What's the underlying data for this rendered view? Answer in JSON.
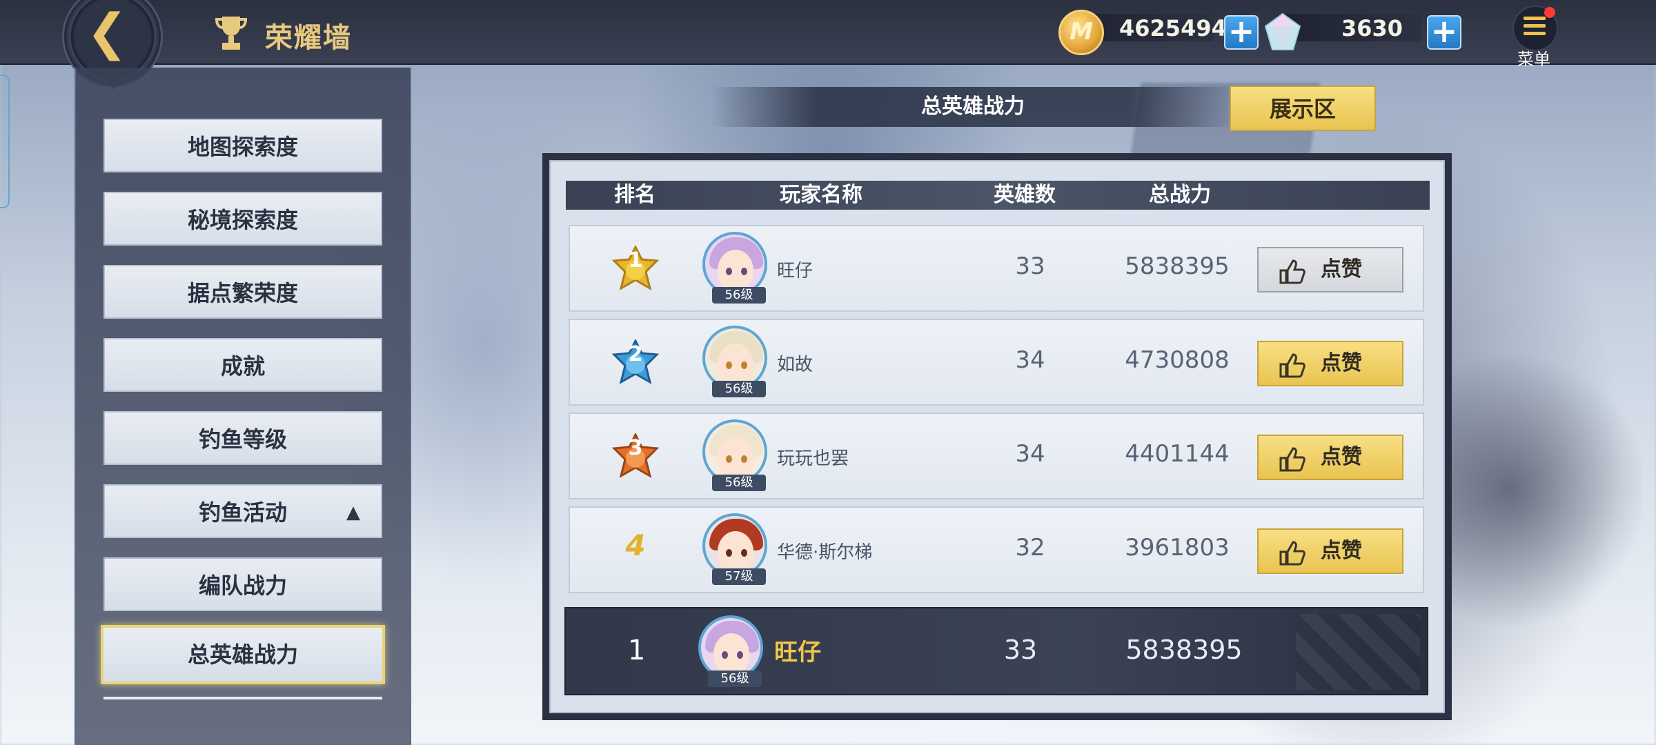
{
  "header": {
    "title": "荣耀墙",
    "coins": "4625494",
    "coin_symbol": "M",
    "gems": "3630",
    "menu_label": "菜单"
  },
  "sidebar": {
    "items": [
      {
        "label": "地图探索度"
      },
      {
        "label": "秘境探索度"
      },
      {
        "label": "据点繁荣度"
      },
      {
        "label": "成就"
      },
      {
        "label": "钓鱼等级"
      },
      {
        "label": "钓鱼活动"
      },
      {
        "label": "编队战力"
      },
      {
        "label": "总英雄战力",
        "active": true
      }
    ]
  },
  "board": {
    "title": "总英雄战力",
    "display_button": "展示区",
    "columns": [
      "排名",
      "玩家名称",
      "英雄数",
      "总战力"
    ],
    "rows": [
      {
        "rank": "1",
        "name": "旺仔",
        "level": "56级",
        "heroes": "33",
        "power": "5838395",
        "like": "点赞",
        "like_enabled": false
      },
      {
        "rank": "2",
        "name": "如故",
        "level": "56级",
        "heroes": "34",
        "power": "4730808",
        "like": "点赞",
        "like_enabled": true
      },
      {
        "rank": "3",
        "name": "玩玩也罢",
        "level": "56级",
        "heroes": "34",
        "power": "4401144",
        "like": "点赞",
        "like_enabled": true
      },
      {
        "rank": "4",
        "name": "华德·斯尔梯",
        "level": "57级",
        "heroes": "32",
        "power": "3961803",
        "like": "点赞",
        "like_enabled": true
      }
    ],
    "self": {
      "rank": "1",
      "name": "旺仔",
      "level": "56级",
      "heroes": "33",
      "power": "5838395"
    }
  },
  "colors": {
    "accent_gold": "#e9c451",
    "topbar": "#2b3040",
    "plus_blue": "#2579c6"
  },
  "icons": {
    "back": "back-chevron-icon",
    "trophy": "trophy-icon",
    "coin": "coin-icon",
    "gem": "gem-icon",
    "plus": "plus-icon",
    "menu": "menu-icon",
    "like": "thumbs-up-icon",
    "medal": "rank-medal-icon",
    "collapse": "collapse-caret-icon"
  }
}
